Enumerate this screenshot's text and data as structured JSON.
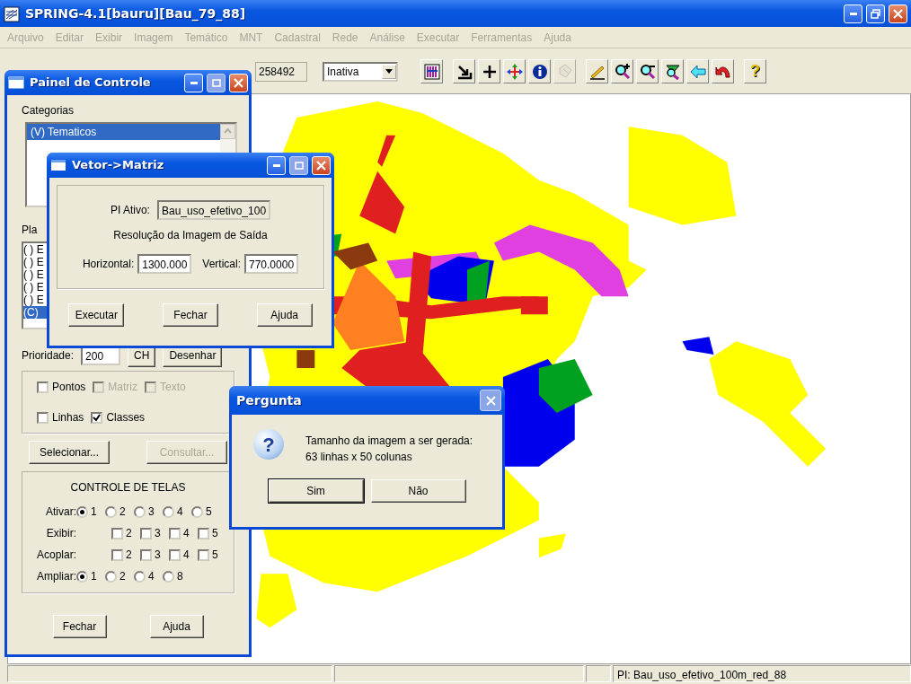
{
  "window": {
    "title": "SPRING-4.1[bauru][Bau_79_88]"
  },
  "menu": [
    {
      "label": "Arquivo",
      "disabled": true
    },
    {
      "label": "Editar",
      "disabled": true
    },
    {
      "label": "Exibir",
      "disabled": true
    },
    {
      "label": "Imagem",
      "disabled": true
    },
    {
      "label": "Temático",
      "disabled": true
    },
    {
      "label": "MNT",
      "disabled": true
    },
    {
      "label": "Cadastral",
      "disabled": true
    },
    {
      "label": "Rede",
      "disabled": true
    },
    {
      "label": "Análise",
      "disabled": true
    },
    {
      "label": "Executar",
      "disabled": true
    },
    {
      "label": "Ferramentas",
      "disabled": true
    },
    {
      "label": "Ajuda",
      "disabled": true
    }
  ],
  "toolbar": {
    "field_value": "258492",
    "mode": {
      "value": "Inativa"
    },
    "tools": [
      {
        "kind": "palette",
        "disabled": false
      },
      {
        "kind": "arrow",
        "disabled": false
      },
      {
        "kind": "crosshair",
        "disabled": false
      },
      {
        "kind": "move",
        "disabled": false
      },
      {
        "kind": "info",
        "disabled": false
      },
      {
        "kind": "select",
        "disabled": true
      },
      {
        "kind": "pencil",
        "disabled": false
      },
      {
        "kind": "zoom-in",
        "disabled": false
      },
      {
        "kind": "zoom-out",
        "disabled": false
      },
      {
        "kind": "zoom-area",
        "disabled": false
      },
      {
        "kind": "back",
        "disabled": false
      },
      {
        "kind": "undo",
        "disabled": false
      },
      {
        "kind": "help",
        "disabled": false,
        "label": "?"
      }
    ]
  },
  "control_panel": {
    "title": "Painel de Controle",
    "categories_label": "Categorias",
    "categories": [
      {
        "label": "(V) Tematicos",
        "selected": true
      }
    ],
    "planes_label": "Pla",
    "planes": [
      {
        "label": "( ) E",
        "selected": false
      },
      {
        "label": "( ) E",
        "selected": false
      },
      {
        "label": "( ) E",
        "selected": false
      },
      {
        "label": "( ) E",
        "selected": false
      },
      {
        "label": "( ) E",
        "selected": false
      },
      {
        "label": "(C)",
        "selected": true
      }
    ],
    "priority": {
      "label": "Prioridade:",
      "value": "200",
      "buttons": [
        "CH",
        "Desenhar"
      ]
    },
    "display_options": [
      {
        "label": "Pontos",
        "checked": false,
        "disabled": false
      },
      {
        "label": "Matriz",
        "checked": false,
        "disabled": true
      },
      {
        "label": "Texto",
        "checked": false,
        "disabled": true
      },
      {
        "label": "Linhas",
        "checked": false,
        "disabled": false
      },
      {
        "label": "Classes",
        "checked": true,
        "disabled": false
      }
    ],
    "buttons": [
      {
        "label": "Selecionar...",
        "disabled": false
      },
      {
        "label": "Consultar...",
        "disabled": true
      }
    ],
    "screens": {
      "title": "CONTROLE DE TELAS",
      "rows": [
        {
          "label": "Ativar:",
          "kind": "radio",
          "options": [
            {
              "label": "1",
              "selected": true
            },
            {
              "label": "2",
              "selected": false
            },
            {
              "label": "3",
              "selected": false
            },
            {
              "label": "4",
              "selected": false
            },
            {
              "label": "5",
              "selected": false
            }
          ]
        },
        {
          "label": "Exibir:",
          "kind": "check",
          "options": [
            {
              "label": "2",
              "checked": false
            },
            {
              "label": "3",
              "checked": false
            },
            {
              "label": "4",
              "checked": false
            },
            {
              "label": "5",
              "checked": false
            }
          ]
        },
        {
          "label": "Acoplar:",
          "kind": "check",
          "options": [
            {
              "label": "2",
              "checked": false
            },
            {
              "label": "3",
              "checked": false
            },
            {
              "label": "4",
              "checked": false
            },
            {
              "label": "5",
              "checked": false
            }
          ]
        },
        {
          "label": "Ampliar:",
          "kind": "radio",
          "options": [
            {
              "label": "1",
              "selected": true
            },
            {
              "label": "2",
              "selected": false
            },
            {
              "label": "4",
              "selected": false
            },
            {
              "label": "8",
              "selected": false
            }
          ]
        }
      ]
    },
    "footer_buttons": [
      "Fechar",
      "Ajuda"
    ]
  },
  "vector_dialog": {
    "title": "Vetor->Matriz",
    "active_pi_label": "PI Ativo:",
    "active_pi": "Bau_uso_efetivo_100",
    "resolution_title": "Resolução da Imagem de Saída",
    "horizontal_label": "Horizontal:",
    "horizontal": "1300.000",
    "vertical_label": "Vertical:",
    "vertical": "770.0000",
    "buttons": [
      "Executar",
      "Fechar",
      "Ajuda"
    ]
  },
  "question_dialog": {
    "title": "Pergunta",
    "icon": "?",
    "message": "Tamanho da imagem a ser gerada:\n 63 linhas x 50 colunas",
    "buttons": [
      {
        "label": "Sim",
        "default": true
      },
      {
        "label": "Não",
        "default": false
      }
    ]
  },
  "status_bar": {
    "text": "PI: Bau_uso_efetivo_100m_red_88"
  }
}
